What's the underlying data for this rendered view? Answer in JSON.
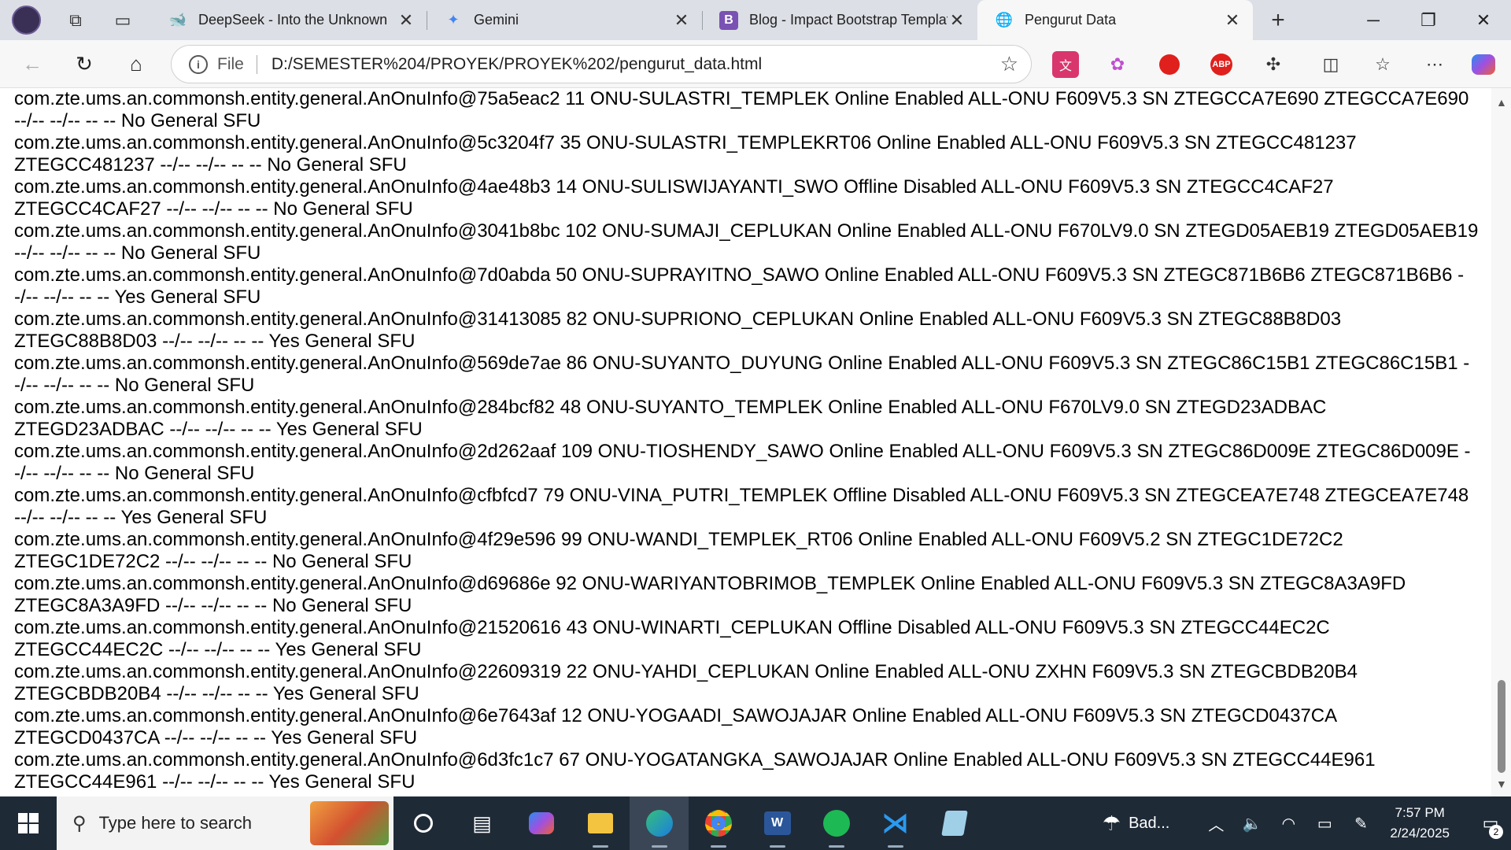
{
  "browser": {
    "tabs": [
      {
        "title": "DeepSeek - Into the Unknown",
        "icon": "deepseek-whale-icon",
        "color": "#4d6bfe"
      },
      {
        "title": "Gemini",
        "icon": "gemini-sparkle-icon",
        "color": "#4285f4"
      },
      {
        "title": "Blog - Impact Bootstrap Template",
        "icon": "bootstrap-icon",
        "color": "#7952b3"
      },
      {
        "title": "Pengurut Data",
        "icon": "globe-icon",
        "color": "#333333"
      }
    ],
    "active_tab_index": 3,
    "address": {
      "protocol_label": "File",
      "url": "D:/SEMESTER%204/PROYEK/PROYEK%202/pengurut_data.html"
    },
    "extensions": [
      "translate-extension-icon",
      "color-extension-icon",
      "adblock-extension-icon",
      "abp-extension-icon",
      "puzzle-extensions-icon",
      "split-screen-icon",
      "favorites-icon",
      "more-icon",
      "copilot-icon"
    ]
  },
  "content": {
    "lines": [
      "com.zte.ums.an.commonsh.entity.general.AnOnuInfo@75a5eac2 11 ONU-SULASTRI_TEMPLEK Online Enabled ALL-ONU F609V5.3 SN ZTEGCCA7E690 ZTEGCCA7E690",
      "--/-- --/-- -- -- No General SFU",
      "com.zte.ums.an.commonsh.entity.general.AnOnuInfo@5c3204f7 35 ONU-SULASTRI_TEMPLEKRT06 Online Enabled ALL-ONU F609V5.3 SN ZTEGCC481237",
      "ZTEGCC481237 --/-- --/-- -- -- No General SFU",
      "com.zte.ums.an.commonsh.entity.general.AnOnuInfo@4ae48b3 14 ONU-SULISWIJAYANTI_SWO Offline Disabled ALL-ONU F609V5.3 SN ZTEGCC4CAF27",
      "ZTEGCC4CAF27 --/-- --/-- -- -- No General SFU",
      "com.zte.ums.an.commonsh.entity.general.AnOnuInfo@3041b8bc 102 ONU-SUMAJI_CEPLUKAN Online Enabled ALL-ONU F670LV9.0 SN ZTEGD05AEB19 ZTEGD05AEB19",
      "--/-- --/-- -- -- No General SFU",
      "com.zte.ums.an.commonsh.entity.general.AnOnuInfo@7d0abda 50 ONU-SUPRAYITNO_SAWO Online Enabled ALL-ONU F609V5.3 SN ZTEGC871B6B6 ZTEGC871B6B6 -",
      "-/-- --/-- -- -- Yes General SFU",
      "com.zte.ums.an.commonsh.entity.general.AnOnuInfo@31413085 82 ONU-SUPRIONO_CEPLUKAN Online Enabled ALL-ONU F609V5.3 SN ZTEGC88B8D03",
      "ZTEGC88B8D03 --/-- --/-- -- -- Yes General SFU",
      "com.zte.ums.an.commonsh.entity.general.AnOnuInfo@569de7ae 86 ONU-SUYANTO_DUYUNG Online Enabled ALL-ONU F609V5.3 SN ZTEGC86C15B1 ZTEGC86C15B1 -",
      "-/-- --/-- -- -- No General SFU",
      "com.zte.ums.an.commonsh.entity.general.AnOnuInfo@284bcf82 48 ONU-SUYANTO_TEMPLEK Online Enabled ALL-ONU F670LV9.0 SN ZTEGD23ADBAC",
      "ZTEGD23ADBAC --/-- --/-- -- -- Yes General SFU",
      "com.zte.ums.an.commonsh.entity.general.AnOnuInfo@2d262aaf 109 ONU-TIOSHENDY_SAWO Online Enabled ALL-ONU F609V5.3 SN ZTEGC86D009E ZTEGC86D009E -",
      "-/-- --/-- -- -- No General SFU",
      "com.zte.ums.an.commonsh.entity.general.AnOnuInfo@cfbfcd7 79 ONU-VINA_PUTRI_TEMPLEK Offline Disabled ALL-ONU F609V5.3 SN ZTEGCEA7E748 ZTEGCEA7E748",
      "--/-- --/-- -- -- Yes General SFU",
      "com.zte.ums.an.commonsh.entity.general.AnOnuInfo@4f29e596 99 ONU-WANDI_TEMPLEK_RT06 Online Enabled ALL-ONU F609V5.2 SN ZTEGC1DE72C2",
      "ZTEGC1DE72C2 --/-- --/-- -- -- No General SFU",
      "com.zte.ums.an.commonsh.entity.general.AnOnuInfo@d69686e 92 ONU-WARIYANTOBRIMOB_TEMPLEK Online Enabled ALL-ONU F609V5.3 SN ZTEGC8A3A9FD",
      "ZTEGC8A3A9FD --/-- --/-- -- -- No General SFU",
      "com.zte.ums.an.commonsh.entity.general.AnOnuInfo@21520616 43 ONU-WINARTI_CEPLUKAN Offline Disabled ALL-ONU F609V5.3 SN ZTEGCC44EC2C",
      "ZTEGCC44EC2C --/-- --/-- -- -- Yes General SFU",
      "com.zte.ums.an.commonsh.entity.general.AnOnuInfo@22609319 22 ONU-YAHDI_CEPLUKAN Online Enabled ALL-ONU ZXHN F609V5.3 SN ZTEGCBDB20B4",
      "ZTEGCBDB20B4 --/-- --/-- -- -- Yes General SFU",
      "com.zte.ums.an.commonsh.entity.general.AnOnuInfo@6e7643af 12 ONU-YOGAADI_SAWOJAJAR Online Enabled ALL-ONU F609V5.3 SN ZTEGCD0437CA",
      "ZTEGCD0437CA --/-- --/-- -- -- Yes General SFU",
      "com.zte.ums.an.commonsh.entity.general.AnOnuInfo@6d3fc1c7 67 ONU-YOGATANGKA_SAWOJAJAR Online Enabled ALL-ONU F609V5.3 SN ZTEGCC44E961",
      "ZTEGCC44E961 --/-- --/-- -- -- Yes General SFU"
    ]
  },
  "taskbar": {
    "search_placeholder": "Type here to search",
    "apps": [
      "cortana-circle-icon",
      "task-view-icon",
      "copilot-app-icon",
      "file-explorer-icon",
      "edge-icon",
      "chrome-icon",
      "word-icon",
      "spotify-icon",
      "vscode-icon",
      "notepad-icon"
    ],
    "active_app": "edge-icon",
    "weather": "Bad...",
    "time": "7:57 PM",
    "date": "2/24/2025",
    "notification_count": "2"
  }
}
